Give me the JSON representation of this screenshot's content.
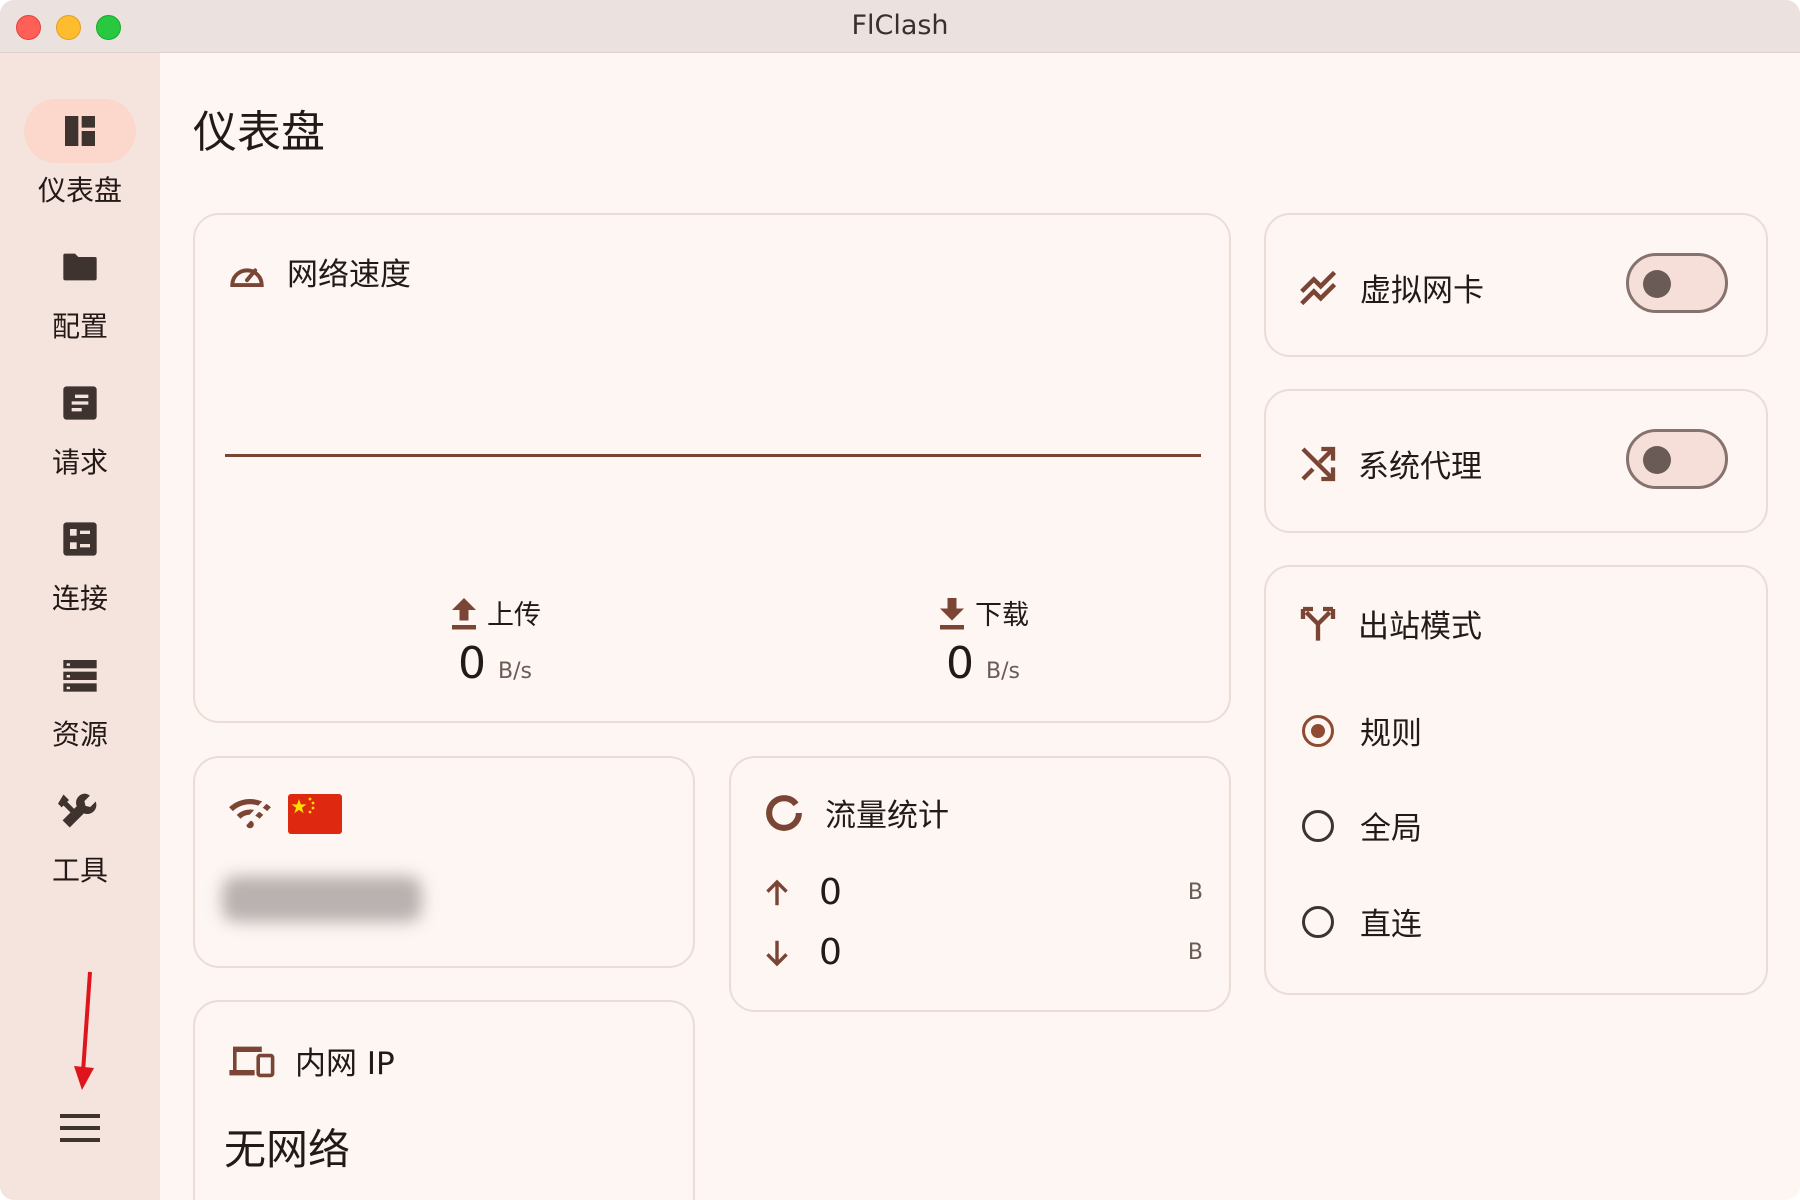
{
  "window": {
    "title": "FlClash"
  },
  "colors": {
    "accent": "#8e4a32",
    "rail_bg": "#f5e4de",
    "active_pill": "#fbd8cb",
    "annotation_arrow": "#e0151b"
  },
  "sidebar": {
    "items": [
      {
        "label": "仪表盘",
        "icon": "dashboard-icon",
        "active": true
      },
      {
        "label": "配置",
        "icon": "folder-icon"
      },
      {
        "label": "请求",
        "icon": "requests-icon"
      },
      {
        "label": "连接",
        "icon": "connections-icon"
      },
      {
        "label": "资源",
        "icon": "storage-icon"
      },
      {
        "label": "工具",
        "icon": "tools-icon"
      }
    ],
    "menu_icon": "hamburger-menu-icon"
  },
  "page": {
    "title": "仪表盘"
  },
  "network_speed": {
    "title": "网络速度",
    "upload": {
      "label": "上传",
      "value": "0",
      "unit": "B/s"
    },
    "download": {
      "label": "下载",
      "value": "0",
      "unit": "B/s"
    }
  },
  "network_detection": {
    "icon": "wifi-icon",
    "flag": "china-flag"
  },
  "traffic": {
    "title": "流量统计",
    "up": {
      "value": "0",
      "unit": "B"
    },
    "down": {
      "value": "0",
      "unit": "B"
    }
  },
  "intranet": {
    "title": "内网 IP",
    "value": "无网络"
  },
  "tun": {
    "label": "虚拟网卡",
    "enabled": false
  },
  "system_proxy": {
    "label": "系统代理",
    "enabled": false
  },
  "outbound": {
    "title": "出站模式",
    "options": [
      {
        "label": "规则",
        "selected": true
      },
      {
        "label": "全局",
        "selected": false
      },
      {
        "label": "直连",
        "selected": false
      }
    ]
  }
}
